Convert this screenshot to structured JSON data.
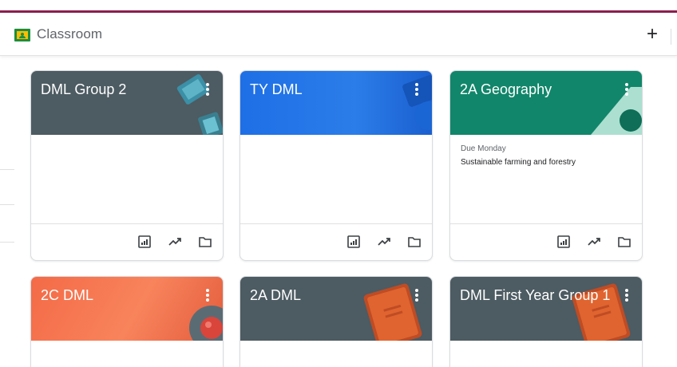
{
  "app": {
    "title": "Classroom",
    "add_label": "+"
  },
  "classes": [
    {
      "name": "DML Group 2",
      "theme": "gray",
      "due_label": "",
      "due_item": "",
      "icons": [
        "gradebook-icon",
        "trending-icon",
        "folder-icon"
      ]
    },
    {
      "name": "TY DML",
      "theme": "blue",
      "due_label": "",
      "due_item": "",
      "icons": [
        "gradebook-icon",
        "trending-icon",
        "folder-icon"
      ]
    },
    {
      "name": "2A Geography",
      "theme": "teal",
      "due_label": "Due Monday",
      "due_item": "Sustainable farming and forestry",
      "icons": [
        "gradebook-icon",
        "trending-icon",
        "folder-icon"
      ]
    },
    {
      "name": "2C DML",
      "theme": "orange"
    },
    {
      "name": "2A DML",
      "theme": "gray"
    },
    {
      "name": "DML First Year Group 1",
      "theme": "gray"
    }
  ],
  "colors": {
    "accent_stripe": "#8b1e4e",
    "gray": "#4d5b62",
    "blue": "#2b7de9",
    "teal": "#11866a",
    "orange": "#f8845c"
  }
}
